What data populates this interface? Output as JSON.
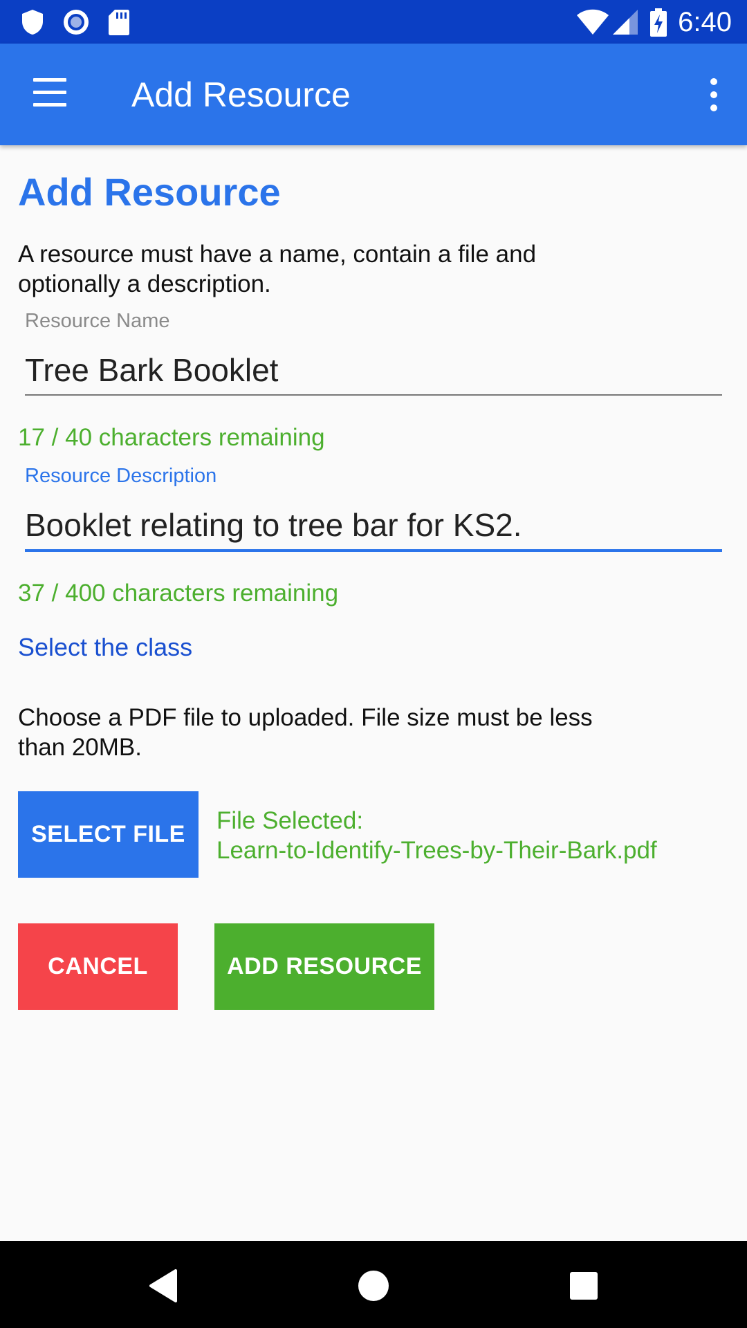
{
  "status_bar": {
    "time": "6:40",
    "left_icons": [
      "shield-icon",
      "record-icon",
      "sd-card-icon"
    ],
    "right_icons": [
      "wifi-icon",
      "signal-icon",
      "battery-charging-icon"
    ]
  },
  "app_bar": {
    "title": "Add Resource",
    "menu_icon": "hamburger-menu-icon",
    "overflow_icon": "more-vert-icon"
  },
  "form": {
    "title": "Add Resource",
    "intro": "A resource must have a name, contain a file and optionally a description.",
    "name_field": {
      "label": "Resource Name",
      "value": "Tree Bark Booklet",
      "counter": "17 / 40 characters remaining"
    },
    "description_field": {
      "label": "Resource Description",
      "value": "Booklet relating to tree bar for KS2.",
      "counter": "37 / 400 characters remaining"
    },
    "select_class_link": "Select the class",
    "file_instructions": "Choose a PDF file to uploaded. File size must be less than 20MB.",
    "select_file_button": "SELECT FILE",
    "file_selected_label": "File Selected:",
    "file_selected_name": "Learn-to-Identify-Trees-by-Their-Bark.pdf",
    "cancel_button": "CANCEL",
    "add_button": "ADD RESOURCE"
  },
  "colors": {
    "status_bar": "#0b3fc4",
    "app_bar": "#2b74ea",
    "accent": "#2b74ea",
    "success": "#4caf2e",
    "danger": "#f5444a",
    "link": "#1a50d0"
  },
  "nav_bar": {
    "icons": [
      "back-icon",
      "home-icon",
      "recents-icon"
    ]
  }
}
